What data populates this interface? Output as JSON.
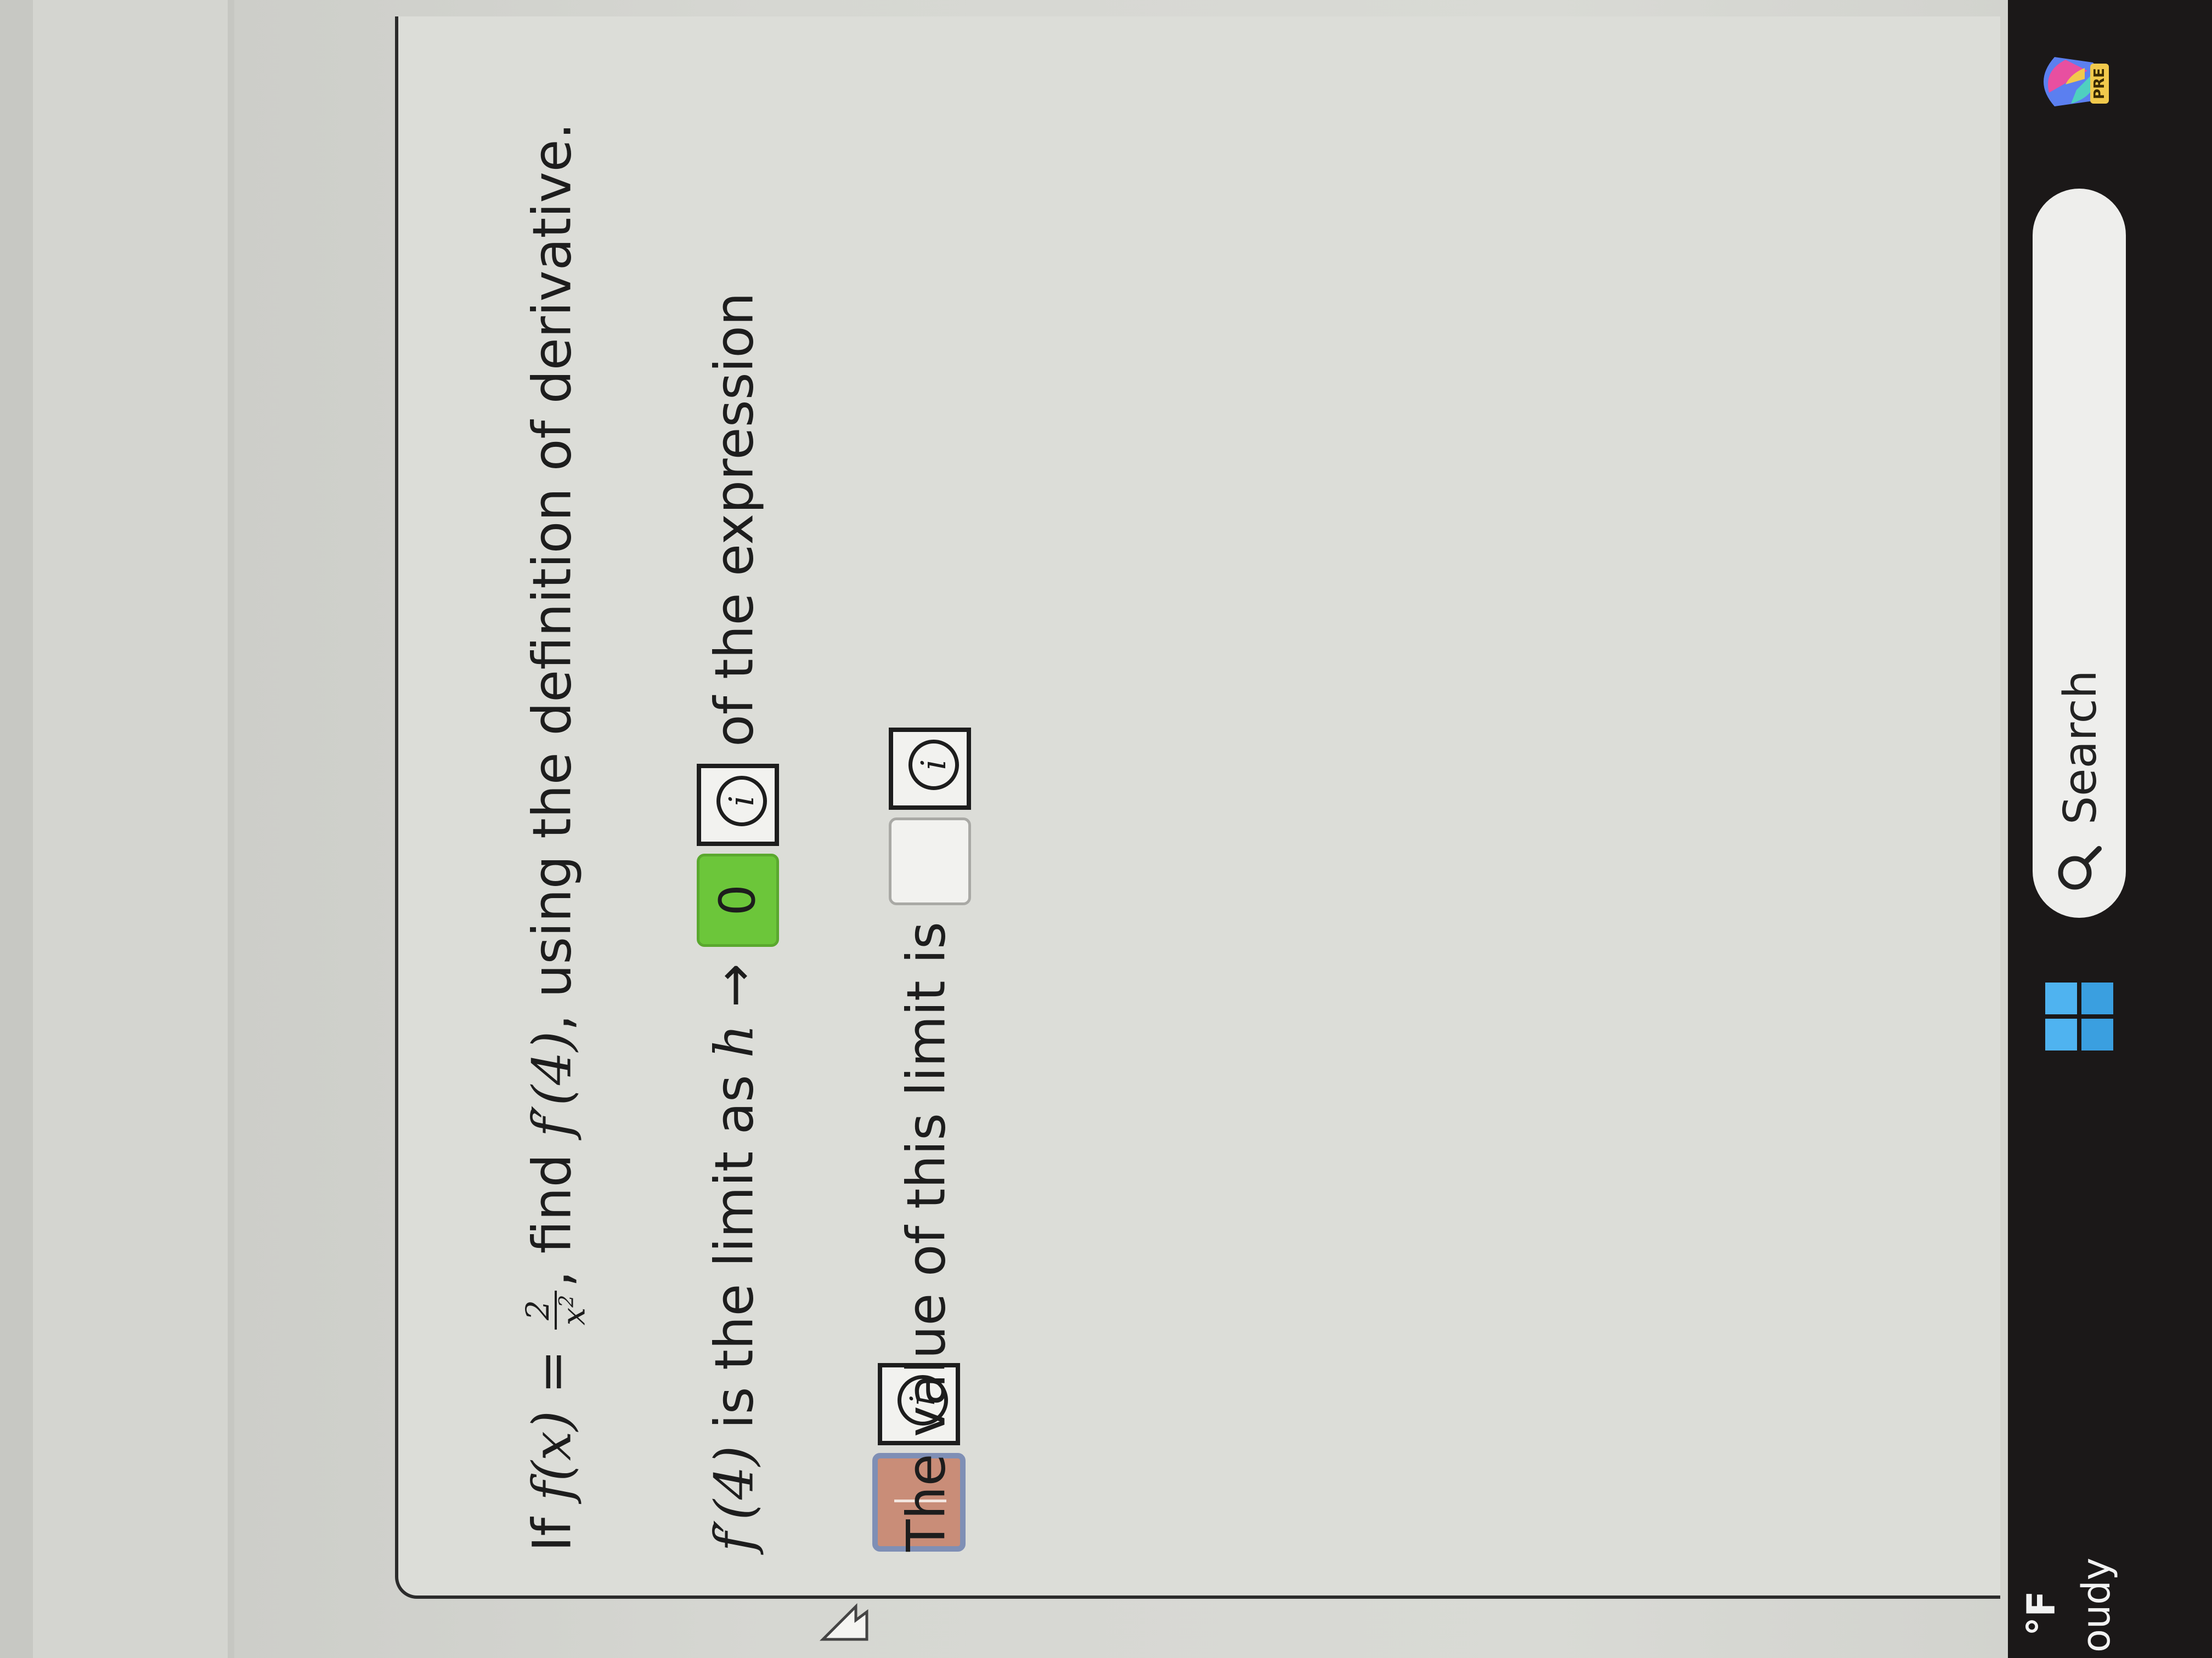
{
  "question": {
    "line1_prefix": "If",
    "line1_fx": "f(x) =",
    "frac_num": "2",
    "frac_den": "x",
    "frac_den_exp": "2",
    "line1_suffix": ", find",
    "line1_fprime": "f′(4)",
    "line1_tail": ", using the definition of derivative.",
    "line2_fprime": "f′(4)",
    "line2_text": " is the limit as",
    "line2_h": "h",
    "line2_arrow": "→",
    "line2_limit_value": "0",
    "line2_tail": " of the expression",
    "line3_text": "The value of this limit is",
    "info_glyph": "i"
  },
  "taskbar": {
    "weather_temp": "°F",
    "weather_condition": "oudy",
    "search_placeholder": "Search",
    "copilot_badge": "PRE"
  },
  "colors": {
    "correct": "#6cc63a",
    "incorrect": "#c98d78",
    "focus_ring": "#7f8fb5"
  }
}
